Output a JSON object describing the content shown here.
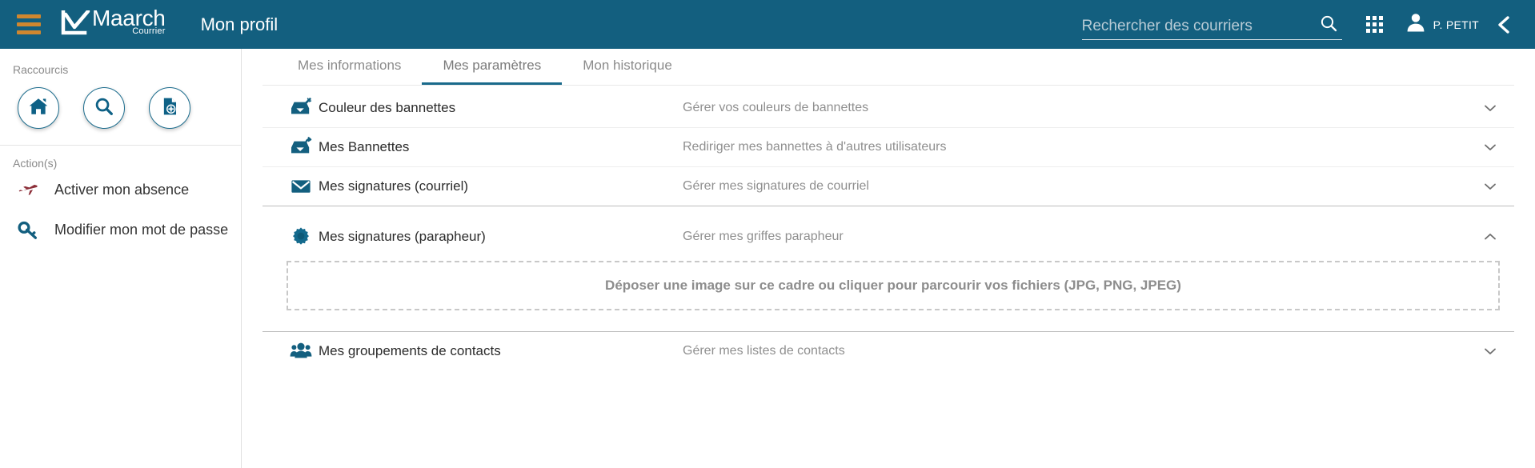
{
  "header": {
    "menu_icon": "hamburger-menu-icon",
    "brand_name": "Maarch",
    "brand_sub": "Courrier",
    "page_title": "Mon profil",
    "search": {
      "placeholder": "Rechercher des courriers",
      "value": "",
      "icon": "search-icon"
    },
    "apps_icon": "apps-grid-icon",
    "user": {
      "avatar_icon": "user-avatar-icon",
      "name": "P. PETIT"
    },
    "collapse_icon": "chevron-left-icon",
    "background_color": "#135f7f",
    "accent_color": "#d0872f"
  },
  "sidebar": {
    "shortcuts_label": "Raccourcis",
    "shortcuts": [
      {
        "name": "shortcut-home",
        "icon": "home-icon"
      },
      {
        "name": "shortcut-search",
        "icon": "search-icon"
      },
      {
        "name": "shortcut-new-document",
        "icon": "document-add-icon"
      }
    ],
    "actions_label": "Action(s)",
    "actions": [
      {
        "label": "Activer mon absence",
        "icon": "airplane-icon",
        "color": "#8c2f39"
      },
      {
        "label": "Modifier mon mot de passe",
        "icon": "key-icon",
        "color": "#135f7f"
      }
    ]
  },
  "main": {
    "tabs": [
      {
        "label": "Mes informations",
        "active": false
      },
      {
        "label": "Mes paramètres",
        "active": true
      },
      {
        "label": "Mon historique",
        "active": false
      }
    ],
    "panels": [
      {
        "title": "Couleur des bannettes",
        "description": "Gérer vos couleurs de bannettes",
        "icon": "inbox-magic-wand-icon",
        "expanded": false,
        "toggle_icon": "chevron-down-icon"
      },
      {
        "title": "Mes Bannettes",
        "description": "Rediriger mes bannettes à d'autres utilisateurs",
        "icon": "inbox-redirect-icon",
        "expanded": false,
        "toggle_icon": "chevron-down-icon"
      },
      {
        "title": "Mes signatures (courriel)",
        "description": "Gérer mes signatures de courriel",
        "icon": "envelope-icon",
        "expanded": false,
        "toggle_icon": "chevron-down-icon"
      },
      {
        "title": "Mes signatures (parapheur)",
        "description": "Gérer mes griffes parapheur",
        "icon": "stamp-badge-icon",
        "expanded": true,
        "toggle_icon": "chevron-up-icon",
        "dropzone_text": "Déposer une image sur ce cadre ou cliquer pour parcourir vos fichiers (JPG, PNG, JPEG)"
      },
      {
        "title": "Mes groupements de contacts",
        "description": "Gérer mes listes de contacts",
        "icon": "contacts-group-icon",
        "expanded": false,
        "toggle_icon": "chevron-down-icon"
      }
    ]
  }
}
